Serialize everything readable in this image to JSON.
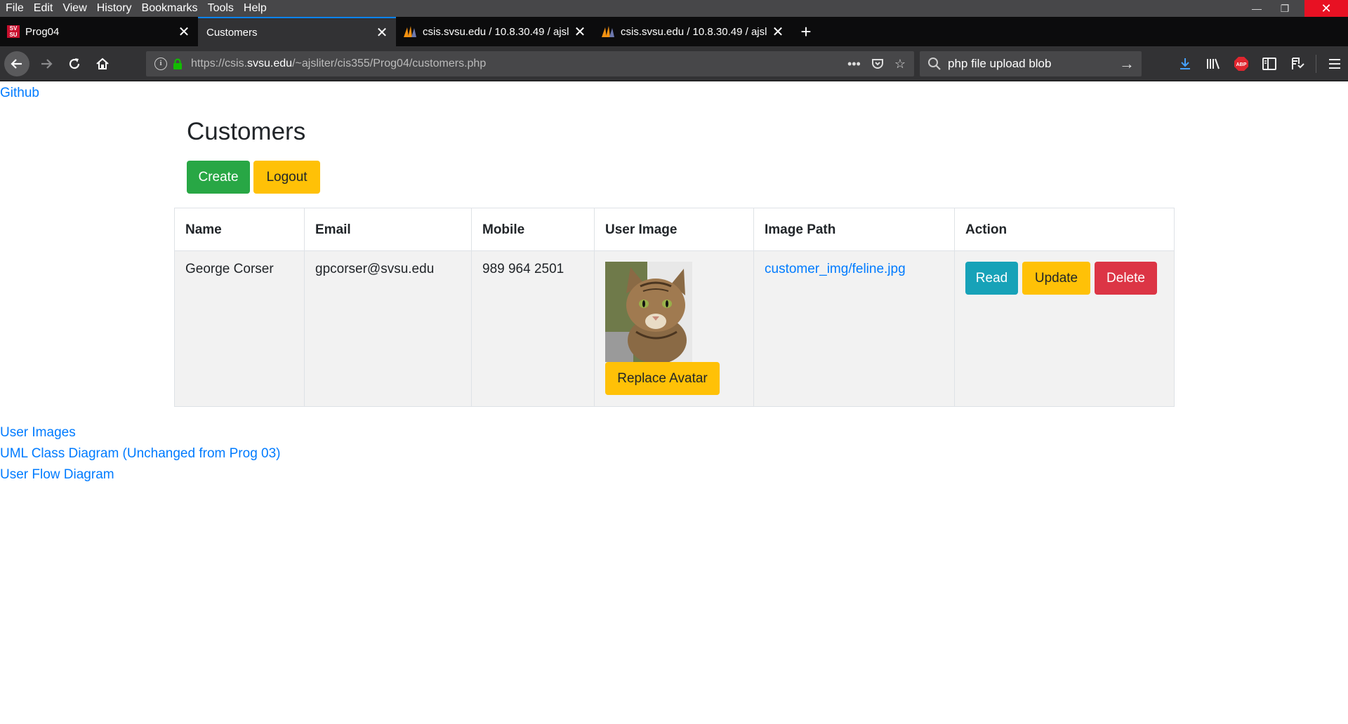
{
  "menu": [
    "File",
    "Edit",
    "View",
    "History",
    "Bookmarks",
    "Tools",
    "Help"
  ],
  "window_controls": {
    "minimize": "—",
    "maximize": "❐",
    "close": "✕"
  },
  "tabs": [
    {
      "title": "Prog04",
      "favicon": "svsu-favicon",
      "favicon_text": "SV SU"
    },
    {
      "title": "Customers",
      "favicon": "",
      "selected": true
    },
    {
      "title": "csis.svsu.edu / 10.8.30.49 / ajsliter",
      "favicon": "phpmyadmin-favicon"
    },
    {
      "title": "csis.svsu.edu / 10.8.30.49 / ajsliter",
      "favicon": "phpmyadmin-favicon"
    }
  ],
  "navbar": {
    "url_prefix": "https://csis.",
    "url_host": "svsu.edu",
    "url_path": "/~ajsliter/cis355/Prog04/customers.php",
    "search_value": "php file upload blob"
  },
  "page": {
    "github_link": "Github",
    "title": "Customers",
    "create_label": "Create",
    "logout_label": "Logout",
    "table": {
      "headers": [
        "Name",
        "Email",
        "Mobile",
        "User Image",
        "Image Path",
        "Action"
      ],
      "rows": [
        {
          "name": "George Corser",
          "email": "gpcorser@svsu.edu",
          "mobile": "989 964 2501",
          "image_path": "customer_img/feline.jpg",
          "replace_label": "Replace Avatar",
          "read_label": "Read",
          "update_label": "Update",
          "delete_label": "Delete"
        }
      ]
    },
    "footer_links": [
      "User Images",
      "UML Class Diagram (Unchanged from Prog 03)",
      "User Flow Diagram"
    ]
  }
}
